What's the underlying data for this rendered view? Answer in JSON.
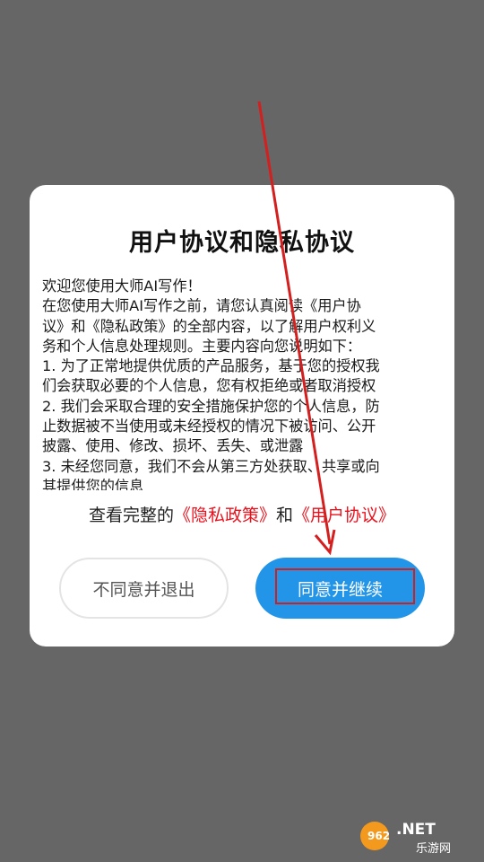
{
  "dialog": {
    "title": "用户协议和隐私协议",
    "body_lines": [
      "欢迎您使用大师AI写作！",
      "在您使用大师AI写作之前，请您认真阅读《用户协",
      "议》和《隐私政策》的全部内容，以了解用户权利义",
      "务和个人信息处理规则。主要内容向您说明如下：",
      "1. 为了正常地提供优质的产品服务，基于您的授权我",
      "们会获取必要的个人信息，您有权拒绝或者取消授权",
      "2. 我们会采取合理的安全措施保护您的个人信息，防",
      "止数据被不当使用或未经授权的情况下被访问、公开",
      "披露、使用、修改、损坏、丢失、或泄露",
      "3. 未经您同意，我们不会从第三方处获取、共享或向",
      "其提供您的信息"
    ],
    "footer": {
      "prefix": "查看完整的",
      "privacy_link": "《隐私政策》",
      "conjunction": "和",
      "user_link": "《用户协议》"
    },
    "decline_button": "不同意并退出",
    "accept_button": "同意并继续"
  },
  "colors": {
    "overlay": "#666666",
    "accent": "#2395e8",
    "link_red": "#e8111c"
  },
  "watermark": {
    "number": "962",
    "domain": ".NET",
    "subtitle": "乐游网"
  }
}
